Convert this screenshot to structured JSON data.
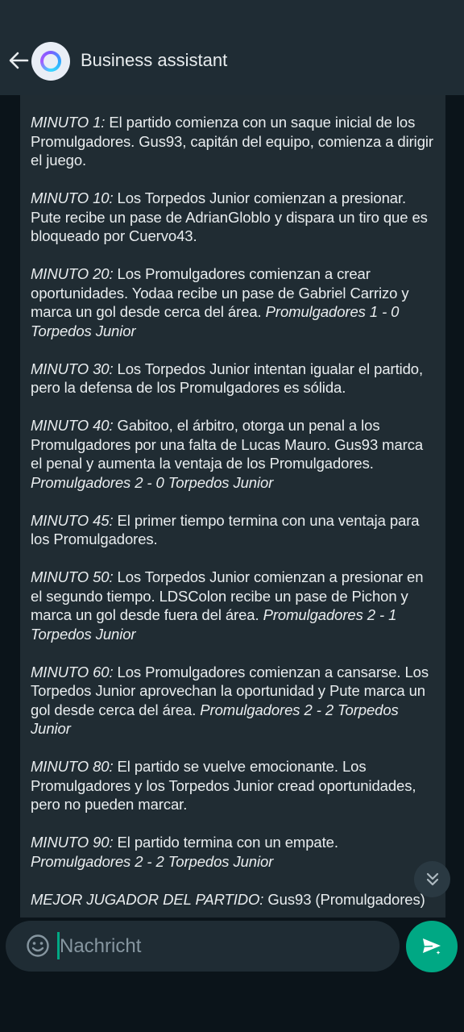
{
  "header": {
    "title": "Business assistant"
  },
  "message": {
    "paragraphs": [
      {
        "label": "MINUTO 1:",
        "text": " El partido comienza con un saque inicial de los Promulgadores. Gus93, capitán del equipo, comienza a dirigir el juego.",
        "score": ""
      },
      {
        "label": "MINUTO 10:",
        "text": " Los Torpedos Junior comienzan a presionar. Pute recibe un pase de AdrianGloblo y dispara un tiro que es bloqueado por Cuervo43.",
        "score": ""
      },
      {
        "label": "MINUTO 20:",
        "text": " Los Promulgadores comienzan a crear oportunidades. Yodaa recibe un pase de Gabriel Carrizo y marca un gol desde cerca del área. ",
        "score": "Promulgadores 1 - 0 Torpedos Junior"
      },
      {
        "label": "MINUTO 30:",
        "text": " Los Torpedos Junior intentan igualar el partido, pero la defensa de los Promulgadores es sólida.",
        "score": ""
      },
      {
        "label": "MINUTO 40:",
        "text": " Gabitoo, el árbitro, otorga un penal a los Promulgadores por una falta de Lucas Mauro. Gus93 marca el penal y aumenta la ventaja de los Promulgadores. ",
        "score": "Promulgadores 2 - 0 Torpedos Junior"
      },
      {
        "label": "MINUTO 45:",
        "text": " El primer tiempo termina con una ventaja para los Promulgadores.",
        "score": ""
      },
      {
        "label": "MINUTO 50:",
        "text": " Los Torpedos Junior comienzan a presionar en el segundo tiempo. LDSColon recibe un pase de Pichon y marca un gol desde fuera del área. ",
        "score": "Promulgadores 2 - 1 Torpedos Junior"
      },
      {
        "label": "MINUTO 60:",
        "text": " Los Promulgadores comienzan a cansarse. Los Torpedos Junior aprovechan la oportunidad y Pute marca un gol desde cerca del área. ",
        "score": "Promulgadores 2 - 2 Torpedos Junior"
      },
      {
        "label": "MINUTO 80:",
        "text": " El partido se vuelve emocionante. Los Promulgadores y los Torpedos Junior cread oportunidades, pero no pueden marcar.",
        "score": ""
      },
      {
        "label": "MINUTO 90:",
        "text": " El partido termina con un empate. ",
        "score": "Promulgadores 2 - 2 Torpedos Junior"
      },
      {
        "label": "MEJOR JUGADOR DEL PARTIDO:",
        "text": " Gus93 (Promulgadores)",
        "score": ""
      }
    ]
  },
  "input": {
    "placeholder": "Nachricht"
  },
  "icons": {
    "back": "arrow-left-icon",
    "avatar": "assistant-ring-logo",
    "scroll": "double-chevron-down-icon",
    "emoji": "emoji-smile-icon",
    "send": "send-sparkle-icon"
  },
  "colors": {
    "accent": "#00a884",
    "bubble": "#202c33",
    "header": "#1f2c34",
    "background": "#0b141a"
  }
}
